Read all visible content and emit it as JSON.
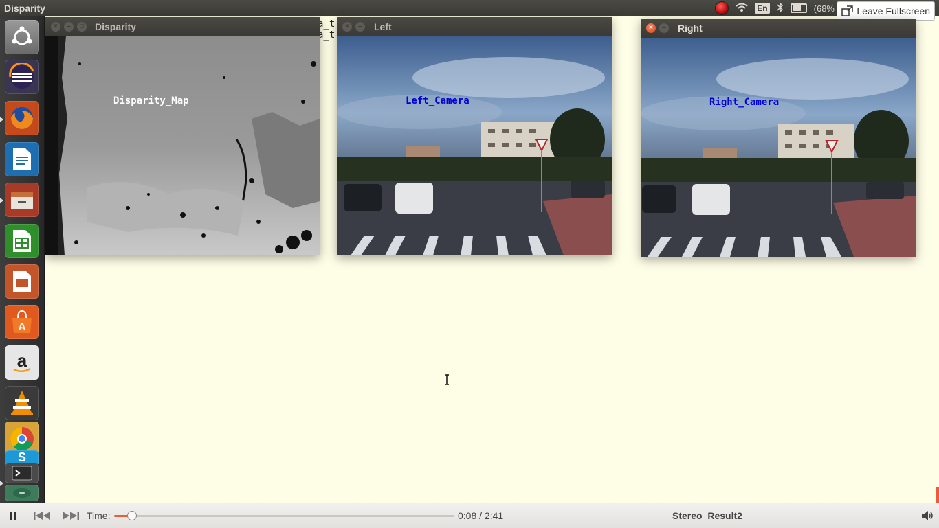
{
  "topbar": {
    "app_title": "Disparity",
    "language": "En",
    "battery_text": "(68%",
    "leave_fullscreen_label": "Leave Fullscreen"
  },
  "launcher": {
    "items": [
      {
        "name": "ubuntu-dash",
        "color": "#7b7b7b"
      },
      {
        "name": "eclipse",
        "color": "#2c2255"
      },
      {
        "name": "firefox",
        "color": "#d86a19"
      },
      {
        "name": "libreoffice-writer",
        "color": "#1d6fb2"
      },
      {
        "name": "files",
        "color": "#b2432d"
      },
      {
        "name": "libreoffice-calc",
        "color": "#2f8f2a"
      },
      {
        "name": "libreoffice-impress",
        "color": "#c2552a"
      },
      {
        "name": "software-center",
        "color": "#e05a1f"
      },
      {
        "name": "amazon",
        "color": "#dcdcdc"
      },
      {
        "name": "vlc",
        "color": "#f28c00"
      },
      {
        "name": "chrome",
        "color": "#e0a92a"
      },
      {
        "name": "skype",
        "color": "#1d9ad6"
      },
      {
        "name": "terminal",
        "color": "#4a4a4a"
      }
    ]
  },
  "windows": {
    "disparity": {
      "title": "Disparity",
      "overlay_text": "Disparity_Map"
    },
    "left": {
      "title": "Left",
      "overlay_text": "Left_Camera"
    },
    "right": {
      "title": "Right",
      "overlay_text": "Right_Camera"
    }
  },
  "background_text": [
    "a_t",
    "a_t"
  ],
  "player": {
    "time_label": "Time:",
    "current_time": "0:08",
    "total_time": "2:41",
    "time_display": "0:08 / 2:41",
    "progress_fraction": 0.05,
    "media_title": "Stereo_Result2",
    "accent_color": "#e5603a"
  }
}
